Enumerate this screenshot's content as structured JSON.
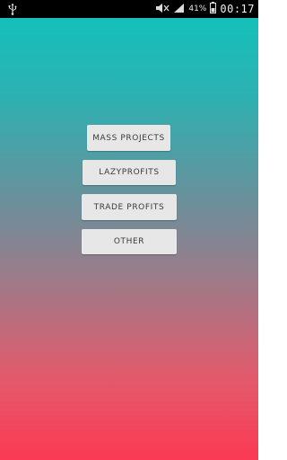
{
  "status_bar": {
    "usb_icon": "usb-icon",
    "mute_icon": "mute-icon",
    "signal_icon": "signal-icon",
    "battery_percent": "41%",
    "battery_icon": "battery-icon",
    "time": "00:17"
  },
  "menu": {
    "buttons": [
      {
        "label": "MASS PROJECTS"
      },
      {
        "label": "LAZYPROFITS"
      },
      {
        "label": "TRADE PROFITS"
      },
      {
        "label": "OTHER"
      }
    ]
  },
  "colors": {
    "gradient_top": "#0fc3bd",
    "gradient_bottom": "#fb3a54",
    "button_bg": "#e7e7e7",
    "button_text": "#3a3a3a"
  }
}
